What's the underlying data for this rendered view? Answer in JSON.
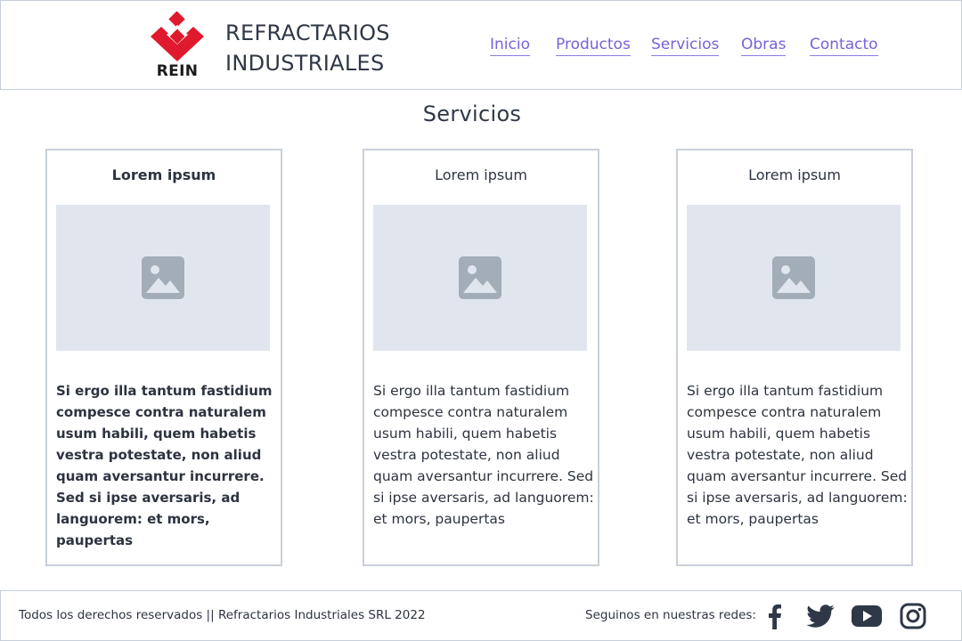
{
  "header": {
    "logo_text": "REIN",
    "brand_line1": "REFRACTARIOS",
    "brand_line2": "INDUSTRIALES",
    "nav": [
      "Inicio",
      "Productos",
      "Servicios",
      "Obras",
      "Contacto"
    ]
  },
  "main": {
    "title": "Servicios",
    "cards": [
      {
        "title": "Lorem ipsum",
        "text": "Si ergo illa tantum fastidium compesce contra naturalem usum habili, quem habetis vestra potestate, non aliud quam aversantur incurrere. Sed si ipse aversaris, ad languorem: et mors, paupertas"
      },
      {
        "title": "Lorem ipsum",
        "text": "Si ergo illa tantum fastidium compesce contra naturalem usum habili, quem habetis vestra potestate, non aliud quam aversantur incurrere. Sed si ipse aversaris, ad languorem: et mors, paupertas"
      },
      {
        "title": "Lorem ipsum",
        "text": "Si ergo illa tantum fastidium compesce contra naturalem usum habili, quem habetis vestra potestate, non aliud quam aversantur incurrere. Sed si ipse aversaris, ad languorem: et mors, paupertas"
      }
    ],
    "image_icon": "image-placeholder-icon"
  },
  "footer": {
    "copyright": "Todos los derechos reservados || Refractarios Industriales SRL 2022",
    "social_label": "Seguinos en nuestras redes:",
    "social_icons": [
      "facebook-icon",
      "twitter-icon",
      "youtube-icon",
      "instagram-icon"
    ]
  },
  "colors": {
    "brand_red": "#e01a2e",
    "nav_link": "#7b61d8",
    "image_placeholder": "#e1e6ee",
    "border": "#c9d0da",
    "text": "#2d3340"
  }
}
